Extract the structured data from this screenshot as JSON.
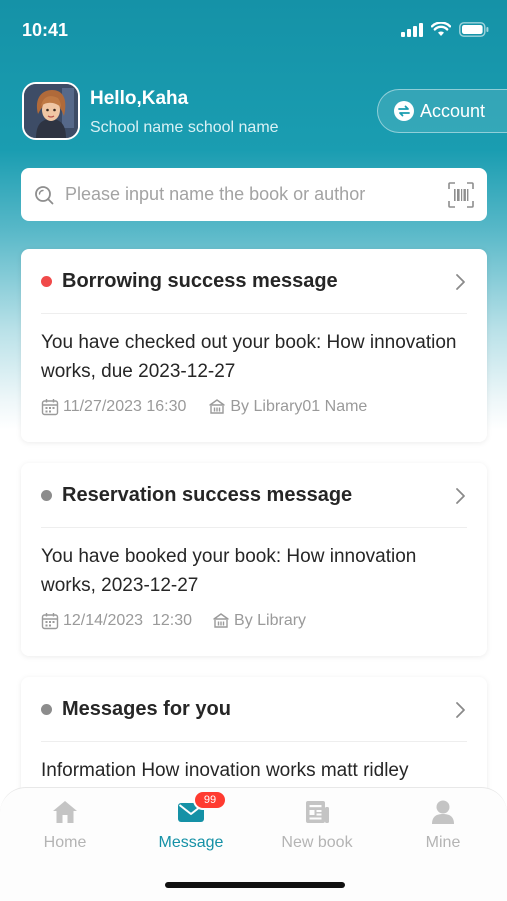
{
  "status_bar": {
    "time": "10:41"
  },
  "profile": {
    "greeting": "Hello,Kaha",
    "school": "School name school name",
    "account_label": "Account"
  },
  "search": {
    "placeholder": "Please input name the book or author"
  },
  "messages": [
    {
      "title": "Borrowing success message",
      "status_color": "#f04a4a",
      "body": "You have checked out your book: How innovation works, due 2023-12-27",
      "date": "11/27/2023 16:30",
      "source": "By Library01 Name"
    },
    {
      "title": "Reservation success message",
      "status_color": "#8c8c8c",
      "body": "You have booked your book: How innovation works, 2023-12-27",
      "date": "12/14/2023  12:30",
      "source": "By Library"
    },
    {
      "title": "Messages for you",
      "status_color": "#8c8c8c",
      "body": "Information How inovation works matt ridley"
    }
  ],
  "tabs": [
    {
      "label": "Home",
      "icon": "home-icon",
      "active": false
    },
    {
      "label": "Message",
      "icon": "envelope-icon",
      "active": true,
      "badge": "99"
    },
    {
      "label": "New book",
      "icon": "newspaper-icon",
      "active": false
    },
    {
      "label": "Mine",
      "icon": "person-icon",
      "active": false
    }
  ],
  "colors": {
    "accent": "#1591a6",
    "header": "#1a9db1",
    "unread_dot": "#f04a4a",
    "read_dot": "#8c8c8c"
  }
}
